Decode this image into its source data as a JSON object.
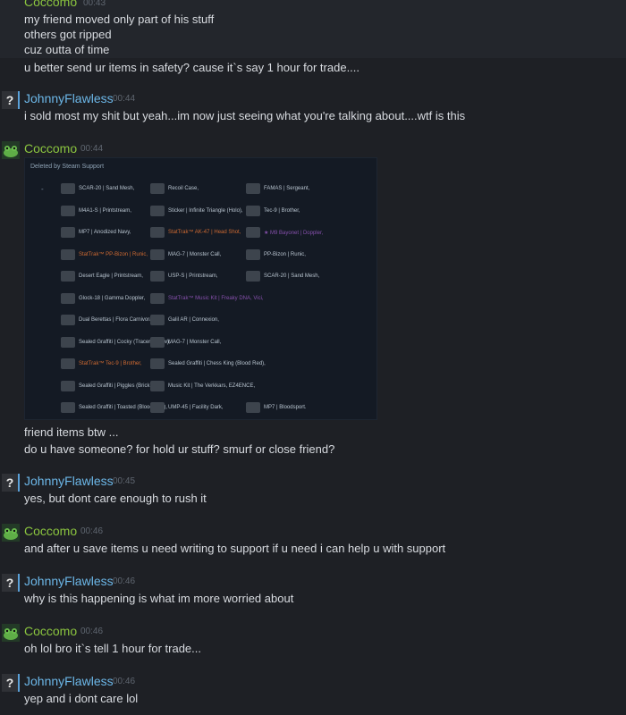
{
  "messages": [
    {
      "author": "Coccomo",
      "time": "00:43",
      "lines": [
        "my friend moved only part of his stuff",
        "others got ripped",
        "cuz outta of time",
        "u better send ur items in safety? cause it`s say 1 hour for trade...."
      ]
    },
    {
      "author": "JohnnyFlawless",
      "time": "00:44",
      "lines": [
        "i sold most my shit but yeah...im now just seeing what you're talking about....wtf is this"
      ]
    },
    {
      "author": "Coccomo",
      "time": "00:44",
      "lines": [
        "friend items btw ...",
        "do u have someone? for hold ur stuff? smurf or close friend?"
      ]
    },
    {
      "author": "JohnnyFlawless",
      "time": "00:45",
      "lines": [
        "yes, but dont care enough to rush it"
      ]
    },
    {
      "author": "Coccomo",
      "time": "00:46",
      "lines": [
        "and after u save items u need writing to support if u need i can help u with support"
      ]
    },
    {
      "author": "JohnnyFlawless",
      "time": "00:46",
      "lines": [
        "why is this happening is what im more worried about"
      ]
    },
    {
      "author": "Coccomo",
      "time": "00:46",
      "lines": [
        "oh lol bro it`s tell 1 hour for trade..."
      ]
    },
    {
      "author": "JohnnyFlawless",
      "time": "00:46",
      "lines": [
        "yep and i dont care lol"
      ]
    }
  ],
  "screenshot": {
    "header": "Deleted by Steam Support",
    "dash": "-",
    "rows": [
      [
        "SCAR-20 | Sand Mesh,",
        "Recoil Case,",
        "FAMAS | Sergeant,"
      ],
      [
        "M4A1-S | Printstream,",
        "Sticker | Infinite Triangle (Holo),",
        "Tec-9 | Brother,"
      ],
      [
        "MP7 | Anodized Navy,",
        "StatTrak™ AK-47 | Head Shot,",
        "★ M9 Bayonet | Doppler,"
      ],
      [
        "StatTrak™ PP-Bizon | Runic,",
        "MAG-7 | Monster Call,",
        "PP-Bizon | Runic,"
      ],
      [
        "Desert Eagle | Printstream,",
        "USP-S | Printstream,",
        "SCAR-20 | Sand Mesh,"
      ],
      [
        "Glock-18 | Gamma Doppler,",
        "StatTrak™ Music Kit | Freaky DNA, Vici,",
        ""
      ],
      [
        "Dual Berettas | Flora Carnivora,",
        "Galil AR | Connexion,",
        ""
      ],
      [
        "Sealed Graffiti | Cocky (Tracer Yellow),",
        "MAG-7 | Monster Call,",
        ""
      ],
      [
        "StatTrak™ Tec-9 | Brother,",
        "Sealed Graffiti | Chess King (Blood Red),",
        ""
      ],
      [
        "Sealed Graffiti | Piggles (Brick Red),",
        "Music Kit | The Verkkars, EZ4ENCE,",
        ""
      ],
      [
        "Sealed Graffiti | Toasted (Blood Red),",
        "UMP-45 | Facility Dark,",
        "MP7 | Bloodsport."
      ]
    ],
    "orange_items": [
      "StatTrak™ AK-47 | Head Shot,",
      "StatTrak™ PP-Bizon | Runic,",
      "StatTrak™ Tec-9 | Brother,"
    ],
    "purple_items": [
      "★ M9 Bayonet | Doppler,",
      "StatTrak™ Music Kit | Freaky DNA, Vici,"
    ]
  },
  "colors": {
    "coccomo": "#8bc53f",
    "johnny": "#6cb7e8",
    "background": "#1e2025"
  }
}
